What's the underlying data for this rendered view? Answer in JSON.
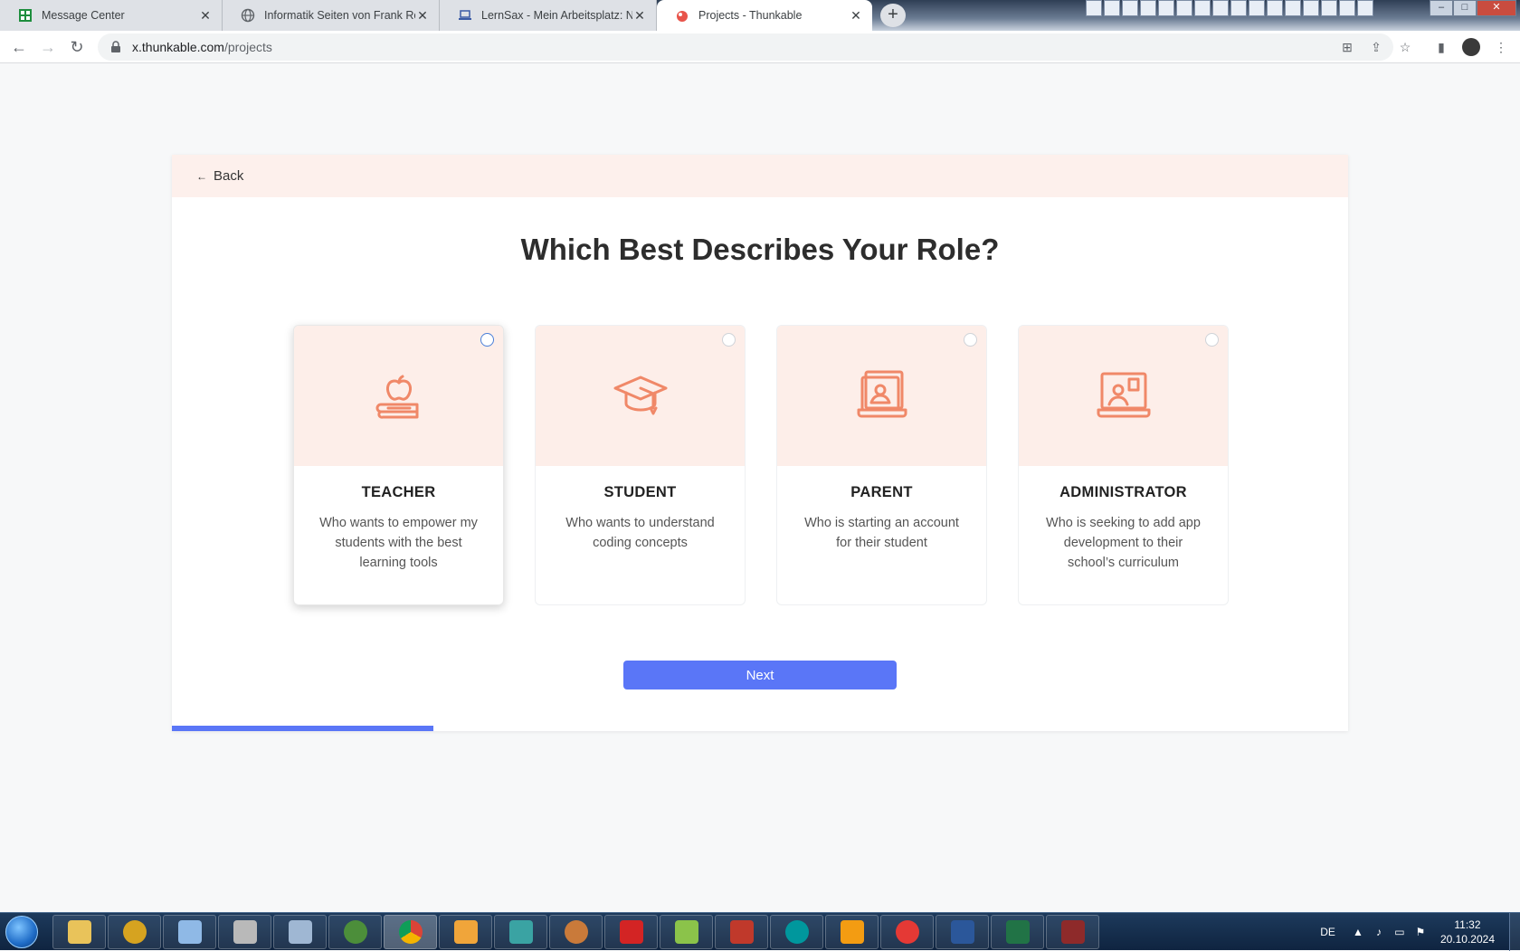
{
  "browser": {
    "tabs": [
      {
        "title": "Message Center",
        "favicon": "spreadsheet-icon",
        "active": false
      },
      {
        "title": "Informatik Seiten von Frank Rost",
        "favicon": "globe-icon",
        "active": false
      },
      {
        "title": "LernSax - Mein Arbeitsplatz: Noti",
        "favicon": "laptop-icon",
        "active": false
      },
      {
        "title": "Projects - Thunkable",
        "favicon": "thunkable-icon",
        "active": true
      }
    ],
    "close_glyph": "✕",
    "new_tab_glyph": "+",
    "url_host": "x.thunkable.com",
    "url_path": "/projects"
  },
  "page": {
    "back_label": "Back",
    "heading": "Which Best Describes Your Role?",
    "roles": [
      {
        "name": "TEACHER",
        "description": "Who wants to empower my students with the best learning tools",
        "icon": "apple-books-icon",
        "selected": true
      },
      {
        "name": "STUDENT",
        "description": "Who wants to understand coding concepts",
        "icon": "graduation-cap-icon",
        "selected": false
      },
      {
        "name": "PARENT",
        "description": "Who is starting an account for their student",
        "icon": "person-laptop-icon",
        "selected": false
      },
      {
        "name": "ADMINISTRATOR",
        "description": "Who is seeking to add app development to their school’s curriculum",
        "icon": "id-board-icon",
        "selected": false
      }
    ],
    "next_label": "Next",
    "progress_fraction": 0.222,
    "accent_color": "#5a76f7",
    "icon_color": "#f08868"
  },
  "taskbar": {
    "language": "DE",
    "time": "11:32",
    "date": "20.10.2024"
  }
}
